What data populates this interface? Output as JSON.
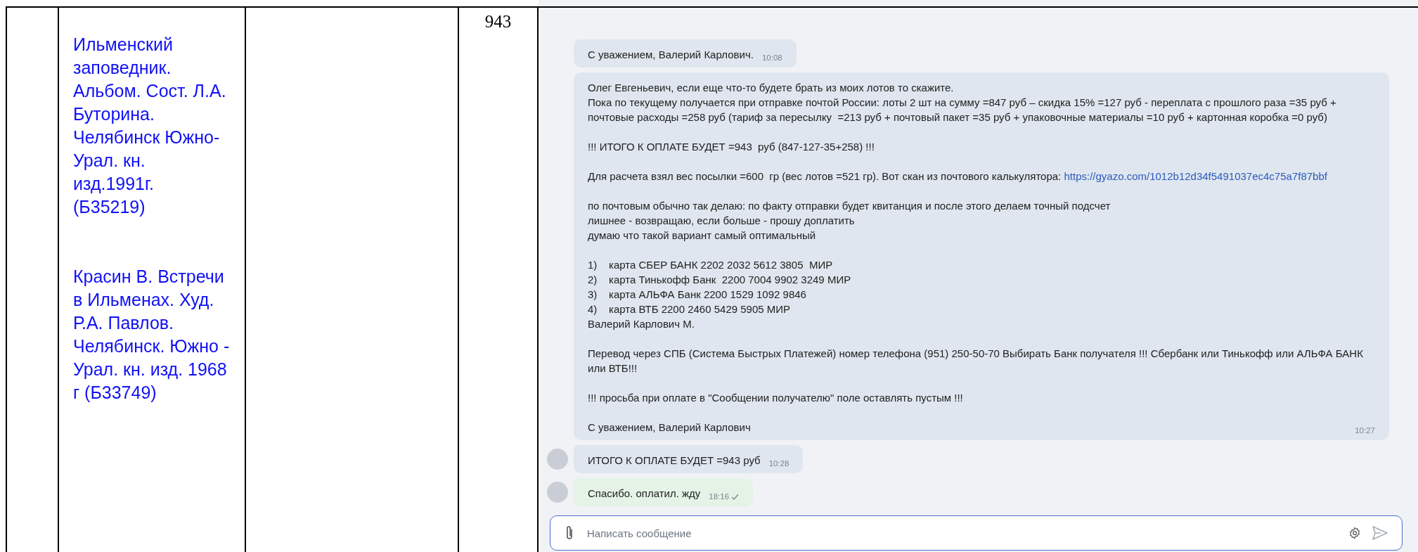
{
  "table": {
    "columns": [
      {
        "kind": "empty"
      },
      {
        "kind": "titles",
        "entries": [
          "Ильменский заповедник. Альбом. Сост. Л.А. Буторина. Челябинск Южно-Урал. кн. изд.1991г. (Б35219)",
          "Красин В. Встречи в Ильменах. Худ. Р.А. Павлов. Челябинск. Южно - Урал. кн. изд. 1968 г (Б33749)"
        ]
      },
      {
        "kind": "empty"
      },
      {
        "kind": "number",
        "value": "943"
      },
      {
        "kind": "chat"
      }
    ]
  },
  "chat": {
    "messages": [
      {
        "kind": "incoming",
        "avatar": false,
        "time": "10:08",
        "read": false,
        "paragraphs": [
          [
            {
              "text": "С уважением, Валерий Карлович."
            }
          ]
        ]
      },
      {
        "kind": "incoming",
        "avatar": false,
        "time": "10:27",
        "read": false,
        "paragraphs": [
          [
            {
              "text": "Олег Евгеньевич, если еще что-то будете брать из моих лотов то скажите."
            },
            {
              "text": "Пока по текущему получается при отправке почтой России: лоты 2 шт на сумму =847 руб – скидка 15% =127 руб - переплата с прошлого раза =35 руб + почтовые расходы =258 руб (тариф за пересылку  =213 руб + почтовый пакет =35 руб + упаковочные материалы =10 руб + картонная коробка =0 руб)"
            }
          ],
          [
            {
              "text": "!!! ИТОГО К ОПЛАТЕ БУДЕТ =943  руб (847-127-35+258) !!!"
            }
          ],
          [
            {
              "text": "Для расчета взял вес посылки =600  гр (вес лотов =521 гр). Вот скан из почтового калькулятора: ",
              "link": "https://gyazo.com/1012b12d34f5491037ec4c75a7f87bbf"
            }
          ],
          [
            {
              "text": "по почтовым обычно так делаю: по факту отправки будет квитанция и после этого делаем точный подсчет"
            },
            {
              "text": "лишнее - возвращаю, если больше - прошу доплатить"
            },
            {
              "text": "думаю что такой вариант самый оптимальный"
            }
          ],
          [
            {
              "text": "1)    карта СБЕР БАНК 2202 2032 5612 3805  МИР"
            },
            {
              "text": "2)    карта Тинькофф Банк  2200 7004 9902 3249 МИР"
            },
            {
              "text": "3)    карта АЛЬФА Банк 2200 1529 1092 9846"
            },
            {
              "text": "4)    карта ВТБ 2200 2460 5429 5905 МИР"
            },
            {
              "text": "Валерий Карлович М."
            }
          ],
          [
            {
              "text": "Перевод через СПБ (Система Быстрых Платежей) номер телефона (951) 250-50-70 Выбирать Банк получателя !!! Сбербанк или Тинькофф или АЛЬФА БАНК или ВТБ!!!"
            }
          ],
          [
            {
              "text": "!!! просьба при оплате в \"Сообщении получателю\" поле оставлять пустым !!!"
            }
          ],
          [
            {
              "text": "С уважением, Валерий Карлович"
            }
          ]
        ]
      },
      {
        "kind": "incoming",
        "avatar": true,
        "time": "10:28",
        "read": false,
        "paragraphs": [
          [
            {
              "text": "ИТОГО К ОПЛАТЕ БУДЕТ =943 руб"
            }
          ]
        ]
      },
      {
        "kind": "outgoing",
        "avatar": true,
        "time": "18:16",
        "read": true,
        "paragraphs": [
          [
            {
              "text": "Спасибо. оплатил. жду"
            }
          ]
        ]
      }
    ],
    "composer": {
      "placeholder": "Написать сообщение"
    }
  }
}
